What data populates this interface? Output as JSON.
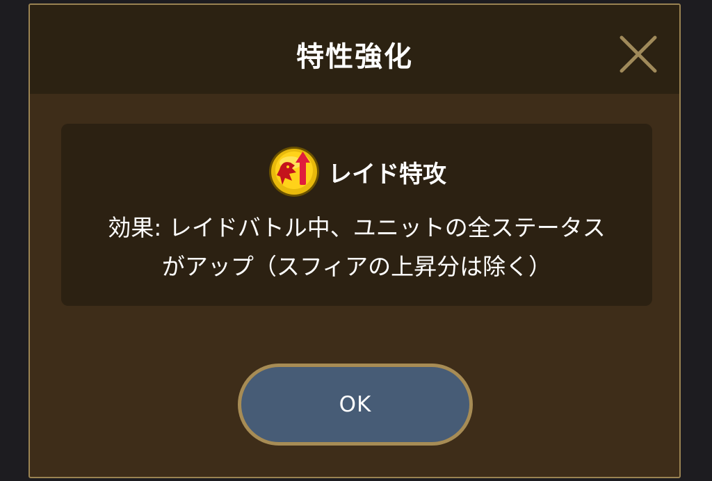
{
  "dialog": {
    "title": "特性強化",
    "close_icon": "close-icon",
    "trait": {
      "icon": "raid-attack-trait-icon",
      "name": "レイド特攻",
      "description_line1": "効果: レイドバトル中、ユニットの全ステータス",
      "description_line2": "がアップ（スフィアの上昇分は除く）"
    },
    "ok_label": "OK"
  },
  "colors": {
    "background": "#1d1c20",
    "dialog_body": "#3e2d19",
    "dialog_header": "#2c2212",
    "panel": "#2c2112",
    "border_gold": "#9a8352",
    "ok_button": "#475c76",
    "ok_border": "#a78c55"
  }
}
